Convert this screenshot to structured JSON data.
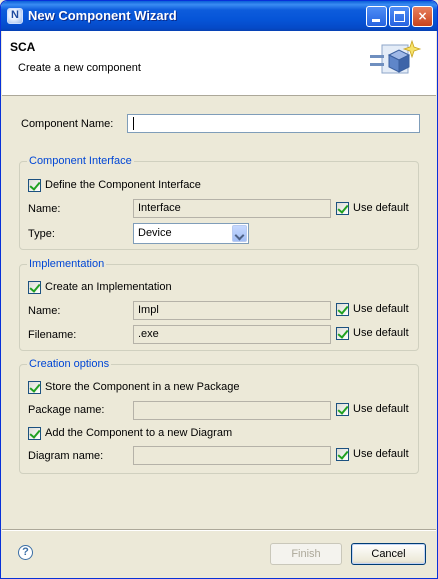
{
  "window": {
    "title": "New Component Wizard",
    "buttons": {
      "minimize": "minimize",
      "maximize": "maximize",
      "close": "×"
    }
  },
  "header": {
    "title": "SCA",
    "description": "Create a new component"
  },
  "component_name": {
    "label": "Component Name:",
    "value": ""
  },
  "interface_group": {
    "title": "Component Interface",
    "define_label": "Define the Component Interface",
    "define_checked": true,
    "name_label": "Name:",
    "name_value": "Interface",
    "name_use_default": "Use default",
    "type_label": "Type:",
    "type_value": "Device"
  },
  "implementation_group": {
    "title": "Implementation",
    "create_label": "Create an Implementation",
    "create_checked": true,
    "name_label": "Name:",
    "name_value": "Impl",
    "name_use_default": "Use default",
    "filename_label": "Filename:",
    "filename_value": ".exe",
    "filename_use_default": "Use default"
  },
  "creation_group": {
    "title": "Creation options",
    "store_label": "Store the Component in a new Package",
    "store_checked": true,
    "package_label": "Package name:",
    "package_value": "",
    "package_use_default": "Use default",
    "diagram_check_label": "Add the Component to a new Diagram",
    "diagram_checked": true,
    "diagram_label": "Diagram name:",
    "diagram_value": "",
    "diagram_use_default": "Use default"
  },
  "footer": {
    "help": "?",
    "finish": "Finish",
    "cancel": "Cancel"
  },
  "colors": {
    "title_bar": "#0655d8",
    "group_title": "#0046d5",
    "check_mark": "#21a121"
  }
}
